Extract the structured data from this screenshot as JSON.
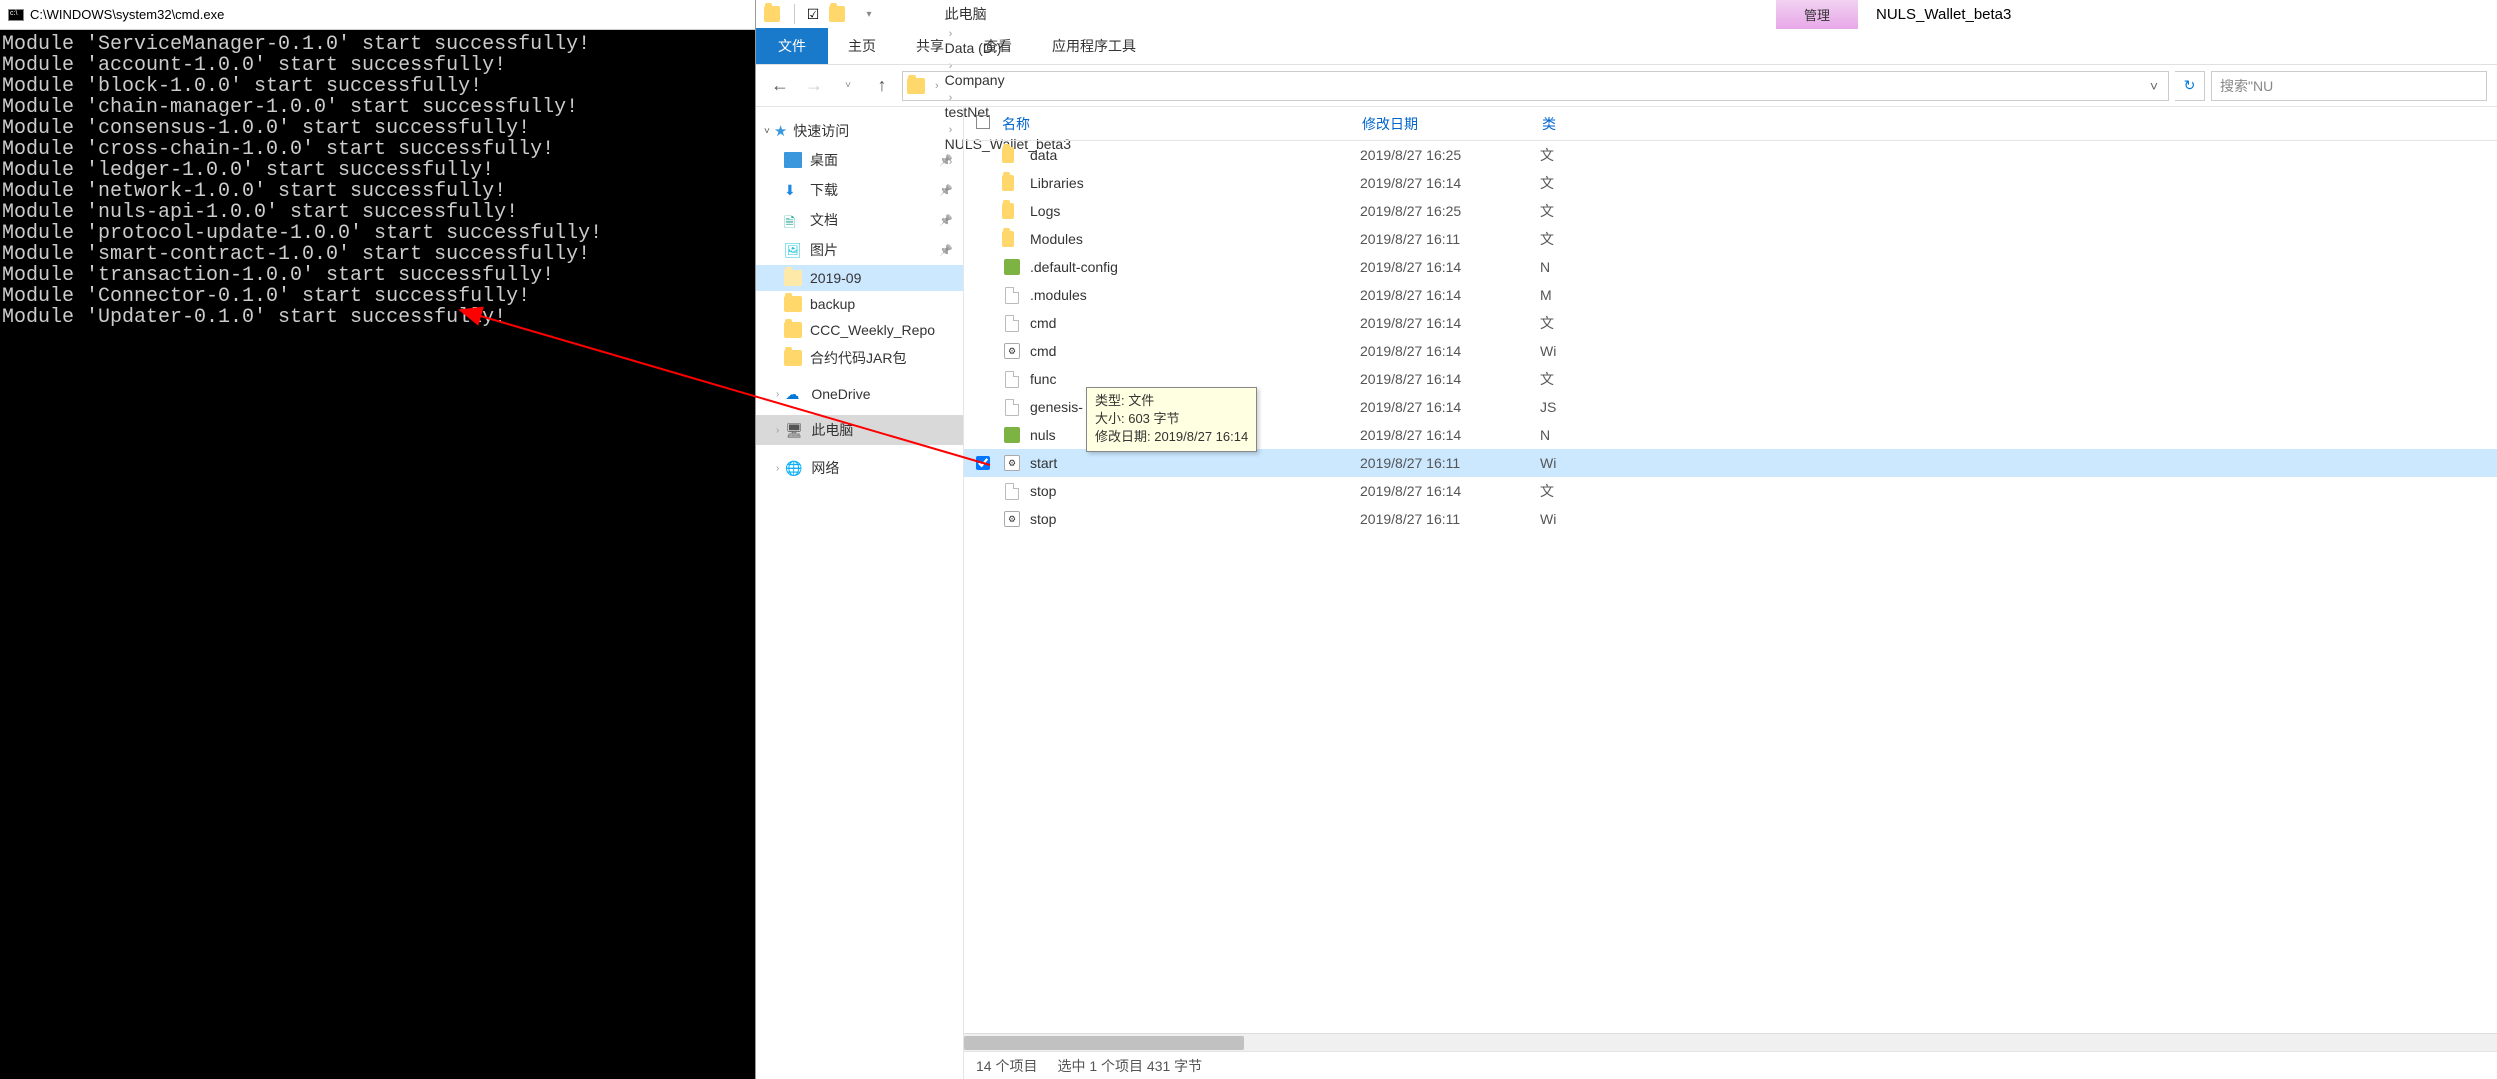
{
  "cmd": {
    "title": "C:\\WINDOWS\\system32\\cmd.exe",
    "lines": [
      "Module 'ServiceManager-0.1.0' start successfully!",
      "Module 'account-1.0.0' start successfully!",
      "Module 'block-1.0.0' start successfully!",
      "Module 'chain-manager-1.0.0' start successfully!",
      "Module 'consensus-1.0.0' start successfully!",
      "Module 'cross-chain-1.0.0' start successfully!",
      "Module 'ledger-1.0.0' start successfully!",
      "Module 'network-1.0.0' start successfully!",
      "Module 'nuls-api-1.0.0' start successfully!",
      "Module 'protocol-update-1.0.0' start successfully!",
      "Module 'smart-contract-1.0.0' start successfully!",
      "Module 'transaction-1.0.0' start successfully!",
      "Module 'Connector-0.1.0' start successfully!",
      "Module 'Updater-0.1.0' start successfully!"
    ]
  },
  "explorer": {
    "title_tab": "管理",
    "title": "NULS_Wallet_beta3",
    "ribbon": {
      "file": "文件",
      "home": "主页",
      "share": "共享",
      "view": "查看",
      "app_tools": "应用程序工具"
    },
    "breadcrumb": [
      "此电脑",
      "Data (D:)",
      "Company",
      "testNet",
      "NULS_Wallet_beta3"
    ],
    "search_placeholder": "搜索\"NU",
    "nav": {
      "quick": "快速访问",
      "desktop": "桌面",
      "downloads": "下载",
      "documents": "文档",
      "pictures": "图片",
      "item_2019": "2019-09",
      "backup": "backup",
      "ccc": "CCC_Weekly_Repo",
      "jar": "合约代码JAR包",
      "onedrive": "OneDrive",
      "this_pc": "此电脑",
      "network": "网络"
    },
    "columns": {
      "name": "名称",
      "date": "修改日期",
      "type": "类"
    },
    "files": [
      {
        "name": "data",
        "date": "2019/8/27 16:25",
        "type": "文",
        "icon": "folder"
      },
      {
        "name": "Libraries",
        "date": "2019/8/27 16:14",
        "type": "文",
        "icon": "folder"
      },
      {
        "name": "Logs",
        "date": "2019/8/27 16:25",
        "type": "文",
        "icon": "folder"
      },
      {
        "name": "Modules",
        "date": "2019/8/27 16:11",
        "type": "文",
        "icon": "folder"
      },
      {
        "name": ".default-config",
        "date": "2019/8/27 16:14",
        "type": "N",
        "icon": "ncf"
      },
      {
        "name": ".modules",
        "date": "2019/8/27 16:14",
        "type": "M",
        "icon": "file"
      },
      {
        "name": "cmd",
        "date": "2019/8/27 16:14",
        "type": "文",
        "icon": "file"
      },
      {
        "name": "cmd",
        "date": "2019/8/27 16:14",
        "type": "Wi",
        "icon": "bat"
      },
      {
        "name": "func",
        "date": "2019/8/27 16:14",
        "type": "文",
        "icon": "file"
      },
      {
        "name": "genesis-",
        "date": "2019/8/27 16:14",
        "type": "JS",
        "icon": "file"
      },
      {
        "name": "nuls",
        "date": "2019/8/27 16:14",
        "type": "N",
        "icon": "ncf"
      },
      {
        "name": "start",
        "date": "2019/8/27 16:11",
        "type": "Wi",
        "icon": "bat",
        "selected": true
      },
      {
        "name": "stop",
        "date": "2019/8/27 16:14",
        "type": "文",
        "icon": "file"
      },
      {
        "name": "stop",
        "date": "2019/8/27 16:11",
        "type": "Wi",
        "icon": "bat"
      }
    ],
    "tooltip": {
      "line1": "类型: 文件",
      "line2": "大小: 603 字节",
      "line3": "修改日期: 2019/8/27 16:14"
    },
    "status": {
      "count": "14 个项目",
      "selected": "选中 1 个项目  431 字节"
    }
  }
}
